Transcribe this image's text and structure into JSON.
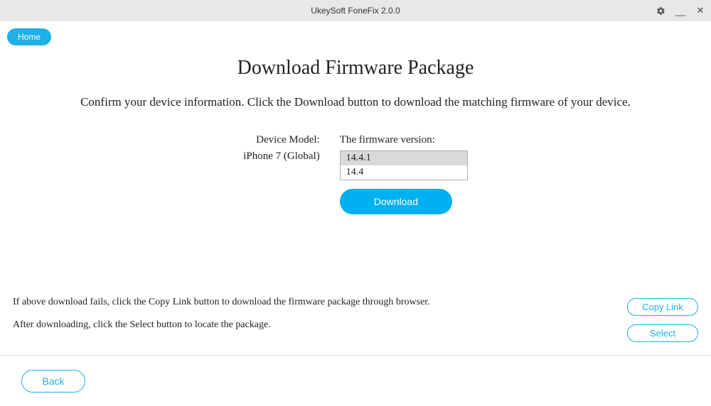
{
  "titlebar": {
    "title": "UkeySoft FoneFix 2.0.0"
  },
  "nav": {
    "home_label": "Home"
  },
  "main": {
    "title": "Download Firmware Package",
    "subtitle": "Confirm your device information. Click the Download button to download the matching firmware of your device.",
    "device_model_label": "Device Model:",
    "device_model_value": "iPhone 7 (Global)",
    "firmware_label": "The firmware version:",
    "firmware_options": [
      "14.4.1",
      "14.4"
    ],
    "firmware_selected": "14.4.1",
    "download_label": "Download"
  },
  "hints": {
    "line1": "If above download fails, click the Copy Link button to download the firmware package through browser.",
    "line2": "After downloading, click the Select button to locate the package."
  },
  "side_buttons": {
    "copy_link": "Copy Link",
    "select": "Select"
  },
  "footer": {
    "back_label": "Back"
  }
}
